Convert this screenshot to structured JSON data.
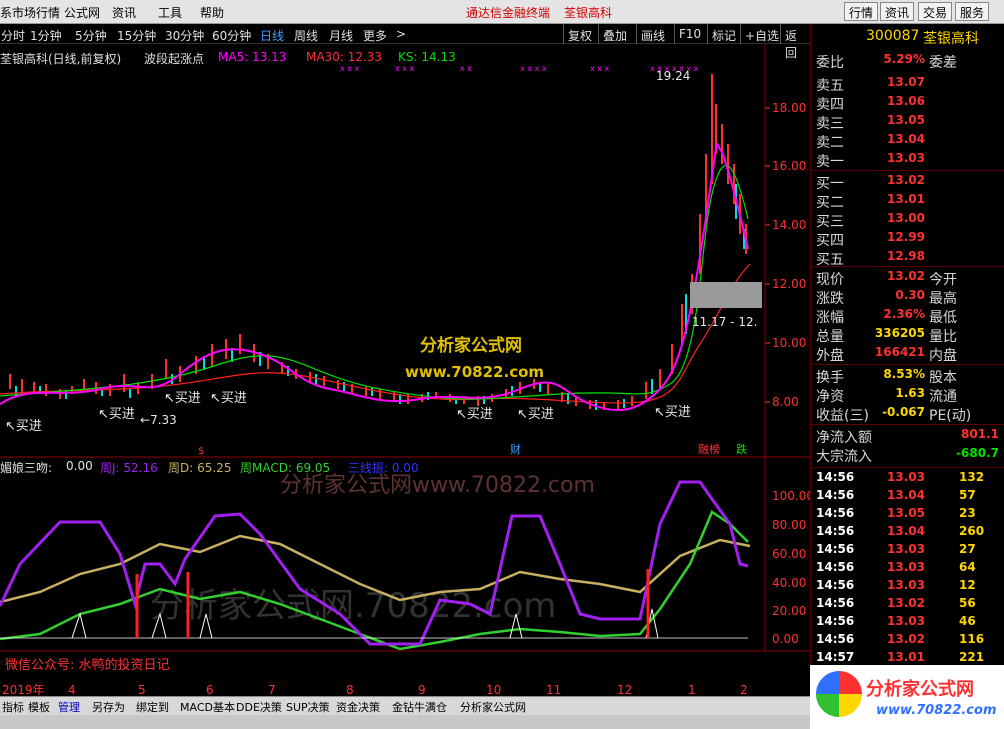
{
  "menu": {
    "items": [
      "系市场行情",
      "公式网",
      "资讯",
      "工具",
      "帮助"
    ],
    "center": [
      "通达信金融终端",
      "荃银高科"
    ],
    "right_buttons": [
      "行情",
      "资讯",
      "交易",
      "服务"
    ]
  },
  "toolbar": {
    "periods": [
      "分时",
      "1分钟",
      "5分钟",
      "15分钟",
      "30分钟",
      "60分钟",
      "日线",
      "周线",
      "月线",
      "更多"
    ],
    "active": "日线",
    "buttons": [
      "复权",
      "叠加",
      "画线",
      "F10",
      "标记",
      "+自选",
      "返回"
    ]
  },
  "chart": {
    "title": "荃银高科(日线,前复权)",
    "formula": "波段起涨点",
    "ma5_label": "MA5: 13.13",
    "ma30_label": "MA30: 12.33",
    "ks_label": "KS: 14.13",
    "peak_label": "19.24",
    "low_label": "7.33",
    "range_label": "11.17 - 12.",
    "buy_label": "买进",
    "y_ticks": [
      "18.00",
      "16.00",
      "14.00",
      "12.00",
      "10.00",
      "8.00"
    ],
    "watermark_site": "分析家公式网",
    "watermark_url": "www.70822.com",
    "markers": {
      "cai": "财",
      "rongbang": "融榜",
      "die": "跌"
    }
  },
  "indicator": {
    "name": "媚娘三吻:",
    "value": "0.00",
    "j_label": "周J: 52.16",
    "d_label": "周D: 65.25",
    "macd_label": "周MACD: 69.05",
    "sanxian_label": "三线振: 0.00",
    "y_ticks": [
      "100.00",
      "80.00",
      "60.00",
      "40.00",
      "20.00",
      "0.00"
    ],
    "wechat": "微信公众号: 水鸭的投资日记",
    "watermark": "分析家公式网www.70822.com",
    "watermark2": "分析家公式网.70822.com"
  },
  "x_axis": [
    "2019年",
    "4",
    "5",
    "6",
    "7",
    "8",
    "9",
    "10",
    "11",
    "12",
    "1",
    "2"
  ],
  "bottom_tabs": [
    "指标",
    "模板",
    "管理",
    "另存为",
    "绑定到",
    "MACD基本",
    "DDE决策",
    "SUP决策",
    "资金决策",
    "金钻牛满仓",
    "分析家公式网"
  ],
  "bottom_selected": "管理",
  "quote": {
    "code": "300087",
    "name": "荃银高科",
    "weibi_label": "委比",
    "weibi": "5.29%",
    "weicha_label": "委差",
    "asks": [
      {
        "label": "卖五",
        "price": "13.07"
      },
      {
        "label": "卖四",
        "price": "13.06"
      },
      {
        "label": "卖三",
        "price": "13.05"
      },
      {
        "label": "卖二",
        "price": "13.04"
      },
      {
        "label": "卖一",
        "price": "13.03"
      }
    ],
    "bids": [
      {
        "label": "买一",
        "price": "13.02"
      },
      {
        "label": "买二",
        "price": "13.01"
      },
      {
        "label": "买三",
        "price": "13.00"
      },
      {
        "label": "买四",
        "price": "12.99"
      },
      {
        "label": "买五",
        "price": "12.98"
      }
    ],
    "stats": [
      {
        "l": "现价",
        "v": "13.02",
        "r": "今开"
      },
      {
        "l": "涨跌",
        "v": "0.30",
        "r": "最高"
      },
      {
        "l": "涨幅",
        "v": "2.36%",
        "r": "最低"
      },
      {
        "l": "总量",
        "v": "336205",
        "r": "量比"
      },
      {
        "l": "外盘",
        "v": "166421",
        "r": "内盘"
      }
    ],
    "stats2": [
      {
        "l": "换手",
        "v": "8.53%",
        "r": "股本"
      },
      {
        "l": "净资",
        "v": "1.63",
        "r": "流通"
      },
      {
        "l": "收益(三)",
        "v": "-0.067",
        "r": "PE(动)"
      }
    ],
    "flow": [
      {
        "l": "净流入额",
        "v": "801.1"
      },
      {
        "l": "大宗流入",
        "v": "-680.7"
      }
    ],
    "ticks": [
      {
        "t": "14:56",
        "p": "13.03",
        "v": "132"
      },
      {
        "t": "14:56",
        "p": "13.04",
        "v": "57"
      },
      {
        "t": "14:56",
        "p": "13.05",
        "v": "23"
      },
      {
        "t": "14:56",
        "p": "13.04",
        "v": "260"
      },
      {
        "t": "14:56",
        "p": "13.03",
        "v": "27"
      },
      {
        "t": "14:56",
        "p": "13.03",
        "v": "64"
      },
      {
        "t": "14:56",
        "p": "13.03",
        "v": "12"
      },
      {
        "t": "14:56",
        "p": "13.02",
        "v": "56"
      },
      {
        "t": "14:56",
        "p": "13.03",
        "v": "46"
      },
      {
        "t": "14:56",
        "p": "13.02",
        "v": "116"
      },
      {
        "t": "14:57",
        "p": "13.01",
        "v": "221"
      }
    ]
  },
  "logo": {
    "text": "分析家公式网",
    "url": "www.70822.com"
  },
  "colors": {
    "up": "#ff3030",
    "down": "#00e0e0",
    "ma5": "#ff00ff",
    "ma30": "#ff3333",
    "ks": "#00ff00",
    "j": "#a020f0",
    "d": "#c8b060",
    "macd": "#40d040"
  }
}
